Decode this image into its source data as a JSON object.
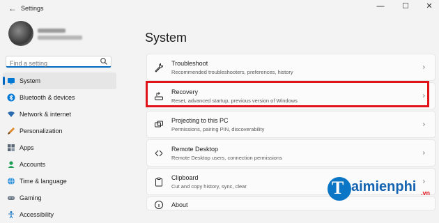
{
  "window": {
    "title": "Settings",
    "back_icon": "back-arrow-icon",
    "minimize": "—",
    "maximize": "☐",
    "close": "✕"
  },
  "search": {
    "placeholder": "Find a setting",
    "value": ""
  },
  "nav": {
    "items": [
      {
        "label": "System",
        "icon": "system-icon"
      },
      {
        "label": "Bluetooth & devices",
        "icon": "bluetooth-icon"
      },
      {
        "label": "Network & internet",
        "icon": "network-icon"
      },
      {
        "label": "Personalization",
        "icon": "brush-icon"
      },
      {
        "label": "Apps",
        "icon": "apps-icon"
      },
      {
        "label": "Accounts",
        "icon": "accounts-icon"
      },
      {
        "label": "Time & language",
        "icon": "globe-icon"
      },
      {
        "label": "Gaming",
        "icon": "gaming-icon"
      },
      {
        "label": "Accessibility",
        "icon": "accessibility-icon"
      }
    ]
  },
  "main": {
    "heading": "System",
    "cards": [
      {
        "title": "Troubleshoot",
        "desc": "Recommended troubleshooters, preferences, history",
        "icon": "wrench-icon"
      },
      {
        "title": "Recovery",
        "desc": "Reset, advanced startup, previous version of Windows",
        "icon": "recovery-icon"
      },
      {
        "title": "Projecting to this PC",
        "desc": "Permissions, pairing PIN, discoverability",
        "icon": "projector-icon"
      },
      {
        "title": "Remote Desktop",
        "desc": "Remote Desktop users, connection permissions",
        "icon": "remote-desktop-icon"
      },
      {
        "title": "Clipboard",
        "desc": "Cut and copy history, sync, clear",
        "icon": "clipboard-icon"
      },
      {
        "title": "About",
        "desc": "",
        "icon": "info-icon"
      }
    ]
  },
  "watermark": {
    "letter": "T",
    "word": "aimienphi",
    "suffix": ".vn"
  },
  "colors": {
    "accent": "#0067c0",
    "highlight": "#e0131b"
  }
}
